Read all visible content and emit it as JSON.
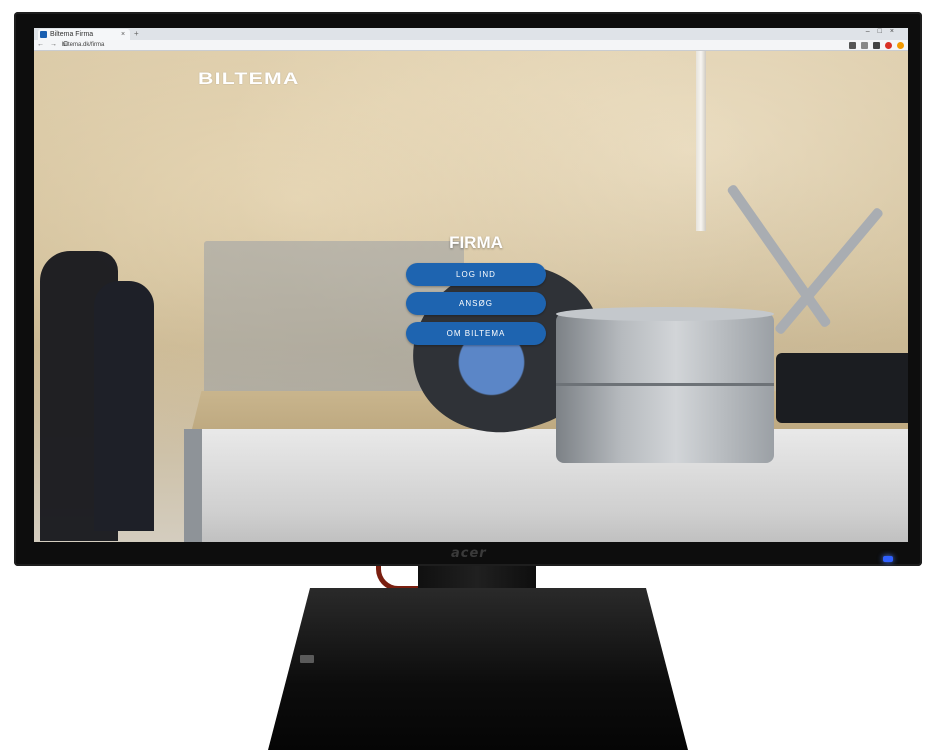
{
  "browser": {
    "tab_title": "Biltema Firma",
    "close_glyph": "×",
    "new_tab_glyph": "+",
    "window_controls": "–□×",
    "nav_glyphs": "← → C",
    "url": "biltema.dk/firma",
    "extension_icons": [
      "bookmark-icon",
      "extension-icon",
      "menu-icon",
      "opera-icon",
      "firefox-icon"
    ]
  },
  "monitor": {
    "brand": "acer"
  },
  "page": {
    "logo": "BILTEMA",
    "heading": "FIRMA",
    "buttons": [
      {
        "label": "LOG IND"
      },
      {
        "label": "ANSØG"
      },
      {
        "label": "OM BILTEMA"
      }
    ],
    "button_color": "#1e64b0"
  }
}
